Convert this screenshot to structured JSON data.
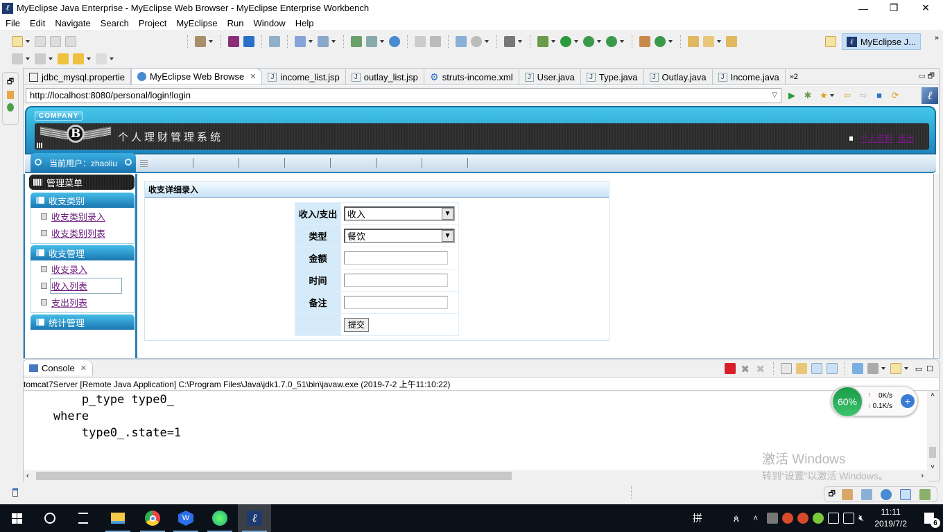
{
  "window": {
    "title": "MyEclipse Java Enterprise - MyEclipse Web Browser - MyEclipse Enterprise Workbench",
    "minimize": "—",
    "maximize": "❐",
    "close": "✕"
  },
  "menu": [
    "File",
    "Edit",
    "Navigate",
    "Search",
    "Project",
    "MyEclipse",
    "Run",
    "Window",
    "Help"
  ],
  "perspective": {
    "label": "MyEclipse J...",
    "overflow": "»"
  },
  "tabs": [
    {
      "label": "jdbc_mysql.propertie",
      "icon": "properties-file-icon"
    },
    {
      "label": "MyEclipse Web Browse",
      "icon": "globe-icon",
      "active": true,
      "close": "✕"
    },
    {
      "label": "income_list.jsp",
      "icon": "jsp-file-icon"
    },
    {
      "label": "outlay_list.jsp",
      "icon": "jsp-file-icon"
    },
    {
      "label": "struts-income.xml",
      "icon": "gear-icon"
    },
    {
      "label": "User.java",
      "icon": "java-file-icon"
    },
    {
      "label": "Type.java",
      "icon": "java-file-icon"
    },
    {
      "label": "Outlay.java",
      "icon": "java-file-icon"
    },
    {
      "label": "Income.java",
      "icon": "java-file-icon"
    }
  ],
  "tab_overflow": "»2",
  "browser": {
    "url": "http://localhost:8080/personal/login!login"
  },
  "site": {
    "company_badge": "COMPANY",
    "logo_letter": "B",
    "title": "个人理财管理系统",
    "links": [
      "个人资料",
      "退出"
    ],
    "current_user_label": "当前用户：zhaoliu"
  },
  "sidebar": {
    "menu_title": "管理菜单",
    "sections": [
      {
        "title": "收支类别",
        "links": [
          "收支类别录入",
          "收支类别列表"
        ]
      },
      {
        "title": "收支管理",
        "links": [
          "收支录入",
          "收入列表",
          "支出列表"
        ]
      },
      {
        "title": "统计管理",
        "links": []
      }
    ]
  },
  "form": {
    "heading": "收支详细录入",
    "fields": [
      {
        "label": "收入/支出",
        "type": "select",
        "value": "收入"
      },
      {
        "label": "类型",
        "type": "select",
        "value": "餐饮"
      },
      {
        "label": "金额",
        "type": "text",
        "value": ""
      },
      {
        "label": "时间",
        "type": "text",
        "value": ""
      },
      {
        "label": "备注",
        "type": "text",
        "value": ""
      }
    ],
    "submit": "提交"
  },
  "console": {
    "tab": "Console",
    "close": "✕",
    "description": "tomcat7Server [Remote Java Application] C:\\Program Files\\Java\\jdk1.7.0_51\\bin\\javaw.exe (2019-7-2 上午11:10:22)",
    "lines": [
      "        p_type type0_",
      "    where",
      "        type0_.state=1"
    ]
  },
  "netmon": {
    "percent": "60%",
    "up": "0K/s",
    "down": "0.1K/s"
  },
  "watermark": {
    "line1": "激活 Windows",
    "line2": "转到“设置”以激活 Windows。"
  },
  "taskbar": {
    "ime": "拼",
    "time": "11:11",
    "date": "2019/7/2",
    "notifications": "6"
  },
  "colors": {
    "accent": "#1a77b2",
    "link_visited": "#6b1a7c",
    "header_dark": "#2a2a2a"
  }
}
